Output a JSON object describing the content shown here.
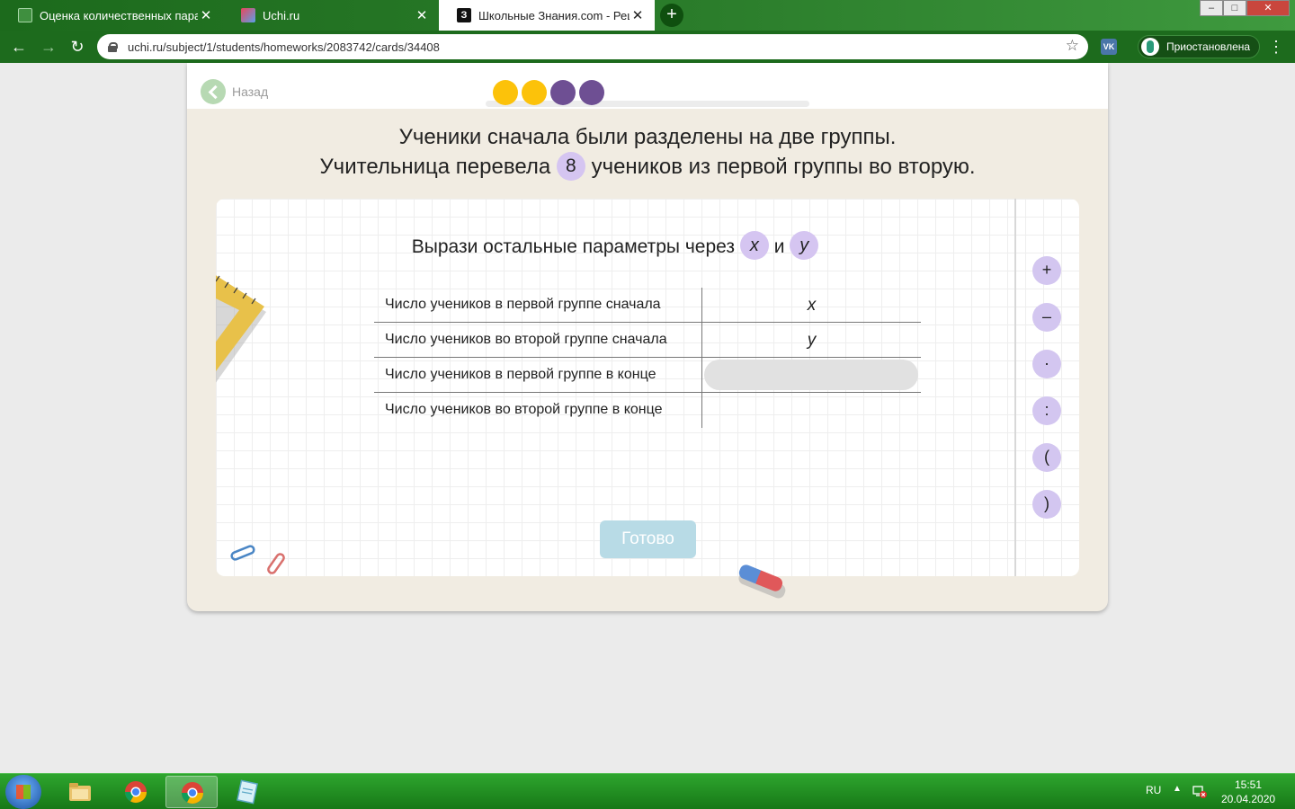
{
  "browser": {
    "tabs": [
      {
        "title": "Оценка количественных парам",
        "active": false
      },
      {
        "title": "Uchi.ru",
        "active": false
      },
      {
        "title": "Школьные Знания.com - Решае",
        "active": true
      }
    ],
    "new_tab_label": "+",
    "url": "uchi.ru/subject/1/students/homeworks/2083742/cards/34408",
    "profile_label": "Приостановлена",
    "vk_label": "VK",
    "window_buttons": {
      "minimize": "–",
      "maximize": "□",
      "close": "✕"
    }
  },
  "page": {
    "back_label": "Назад",
    "progress_dots": [
      {
        "color": "#fcc20a"
      },
      {
        "color": "#fcc20a"
      },
      {
        "color": "#6e4f93"
      },
      {
        "color": "#6e4f93"
      }
    ],
    "task": {
      "line1": "Ученики сначала были разделены на две группы.",
      "line2_before": "Учительница перевела",
      "number": "8",
      "line2_after": "учеников из первой группы во вторую."
    },
    "prompt": {
      "text": "Вырази остальные параметры через",
      "var1": "x",
      "conj": "и",
      "var2": "y"
    },
    "rows": [
      {
        "label": "Число учеников в первой группе сначала",
        "value": "x"
      },
      {
        "label": "Число учеников во второй группе сначала",
        "value": "y"
      },
      {
        "label": "Число учеников в первой группе в конце",
        "value": ""
      },
      {
        "label": "Число учеников во второй группе в конце",
        "value": ""
      }
    ],
    "done_label": "Готово",
    "operators": [
      "+",
      "–",
      "·",
      ":",
      "(",
      ")"
    ]
  },
  "taskbar": {
    "lang": "RU",
    "tray_arrow": "▲",
    "time": "15:51",
    "date": "20.04.2020"
  },
  "colors": {
    "accent_green": "#1d6b1d",
    "chip_purple": "#d5c5f1",
    "done_button": "#b8dbe6"
  }
}
